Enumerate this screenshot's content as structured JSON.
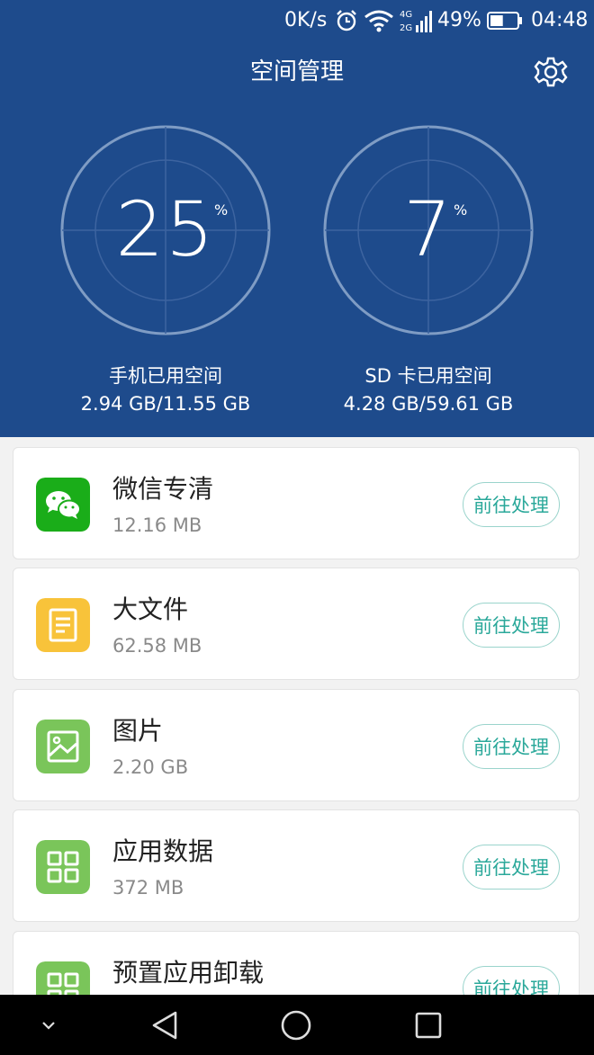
{
  "status_bar": {
    "net_speed": "0K/s",
    "signal_labels": [
      "4G",
      "2G"
    ],
    "battery_percent": "49%",
    "battery_level": 0.49,
    "time": "04:48"
  },
  "header": {
    "title": "空间管理",
    "background_color": "#1e4b8c"
  },
  "gauges": [
    {
      "value": "25",
      "unit": "%",
      "label": "手机已用空间",
      "usage": "2.94 GB/11.55 GB"
    },
    {
      "value": "7",
      "unit": "%",
      "label": "SD 卡已用空间",
      "usage": "4.28 GB/59.61 GB"
    }
  ],
  "items": [
    {
      "icon": "wechat-icon",
      "icon_color": "#1aad19",
      "name": "微信专清",
      "size": "12.16 MB",
      "action": "前往处理"
    },
    {
      "icon": "document-icon",
      "icon_color": "#f8c33a",
      "name": "大文件",
      "size": "62.58 MB",
      "action": "前往处理"
    },
    {
      "icon": "image-icon",
      "icon_color": "#7ac55a",
      "name": "图片",
      "size": "2.20 GB",
      "action": "前往处理"
    },
    {
      "icon": "apps-grid-icon",
      "icon_color": "#7ac55a",
      "name": "应用数据",
      "size": "372 MB",
      "action": "前往处理"
    },
    {
      "icon": "apps-grid-icon",
      "icon_color": "#7ac55a",
      "name": "预置应用卸载",
      "size": "",
      "action": "前往处理"
    }
  ],
  "accent_color": "#2aa89a"
}
